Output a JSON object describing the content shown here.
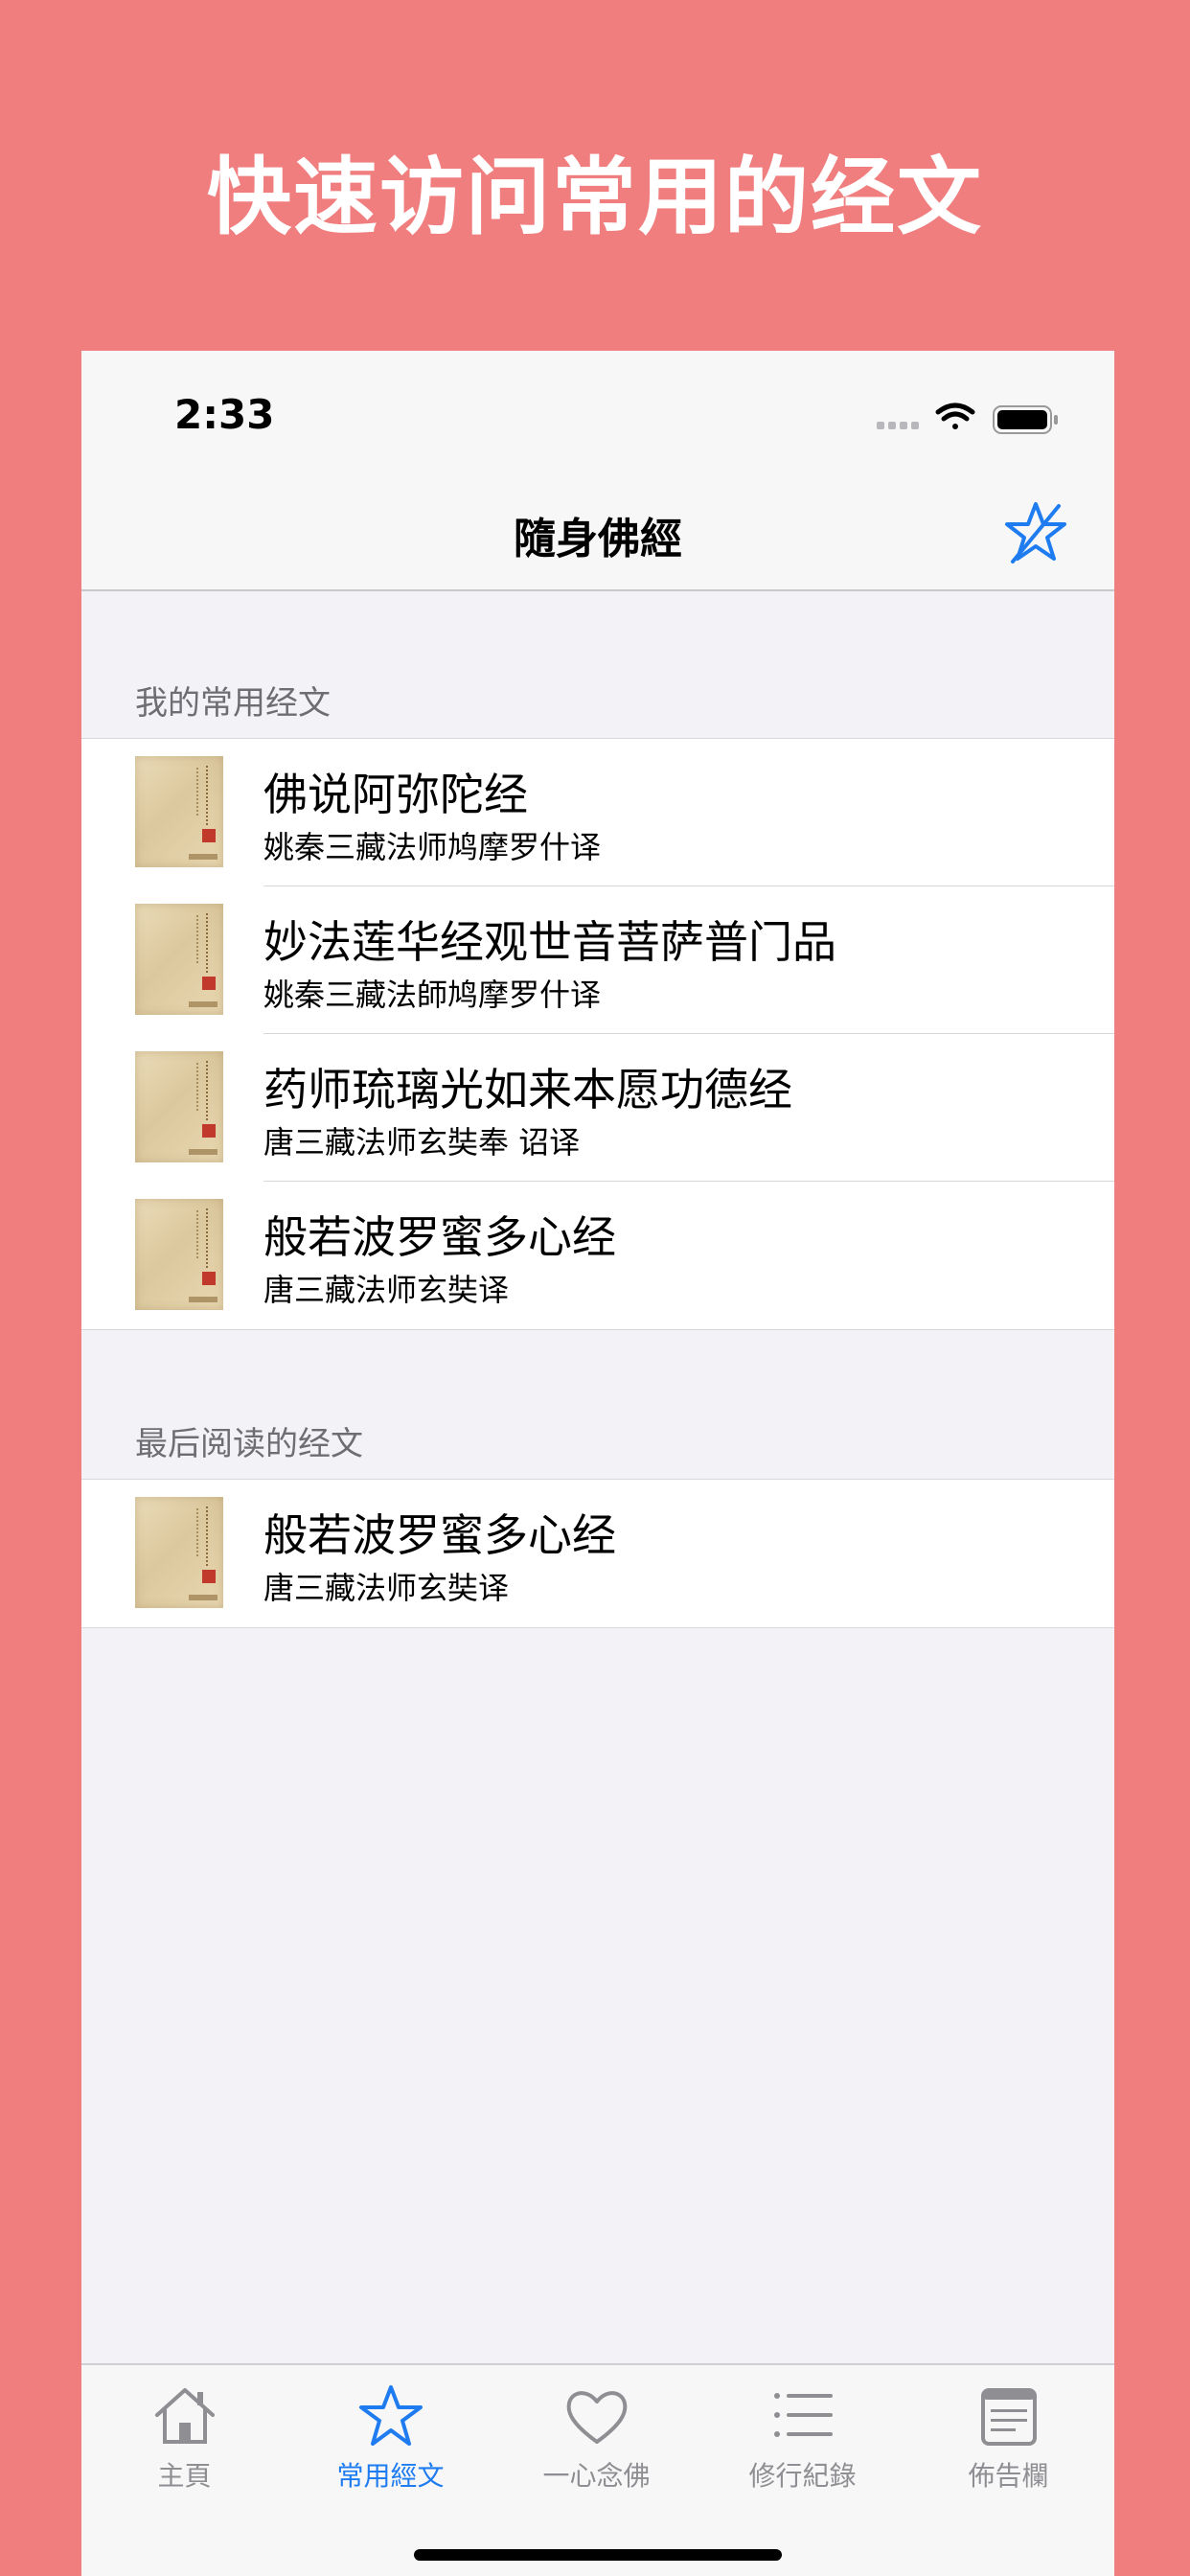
{
  "promo": {
    "title": "快速访问常用的经文"
  },
  "status_bar": {
    "time": "2:33"
  },
  "nav": {
    "title": "隨身佛經",
    "action_icon": "star-icon"
  },
  "sections": {
    "favorites": {
      "header": "我的常用经文",
      "items": [
        {
          "title": "佛说阿弥陀经",
          "subtitle": "姚秦三藏法师鸠摩罗什译"
        },
        {
          "title": "妙法莲华经观世音菩萨普门品",
          "subtitle": "姚秦三藏法師鸠摩罗什译"
        },
        {
          "title": "药师琉璃光如来本愿功德经",
          "subtitle": "唐三藏法师玄奘奉 诏译"
        },
        {
          "title": "般若波罗蜜多心经",
          "subtitle": "唐三藏法师玄奘译"
        }
      ]
    },
    "recent": {
      "header": "最后阅读的经文",
      "items": [
        {
          "title": "般若波罗蜜多心经",
          "subtitle": "唐三藏法师玄奘译"
        }
      ]
    }
  },
  "tabs": [
    {
      "label": "主頁",
      "icon": "home-icon",
      "active": false
    },
    {
      "label": "常用經文",
      "icon": "star-icon",
      "active": true
    },
    {
      "label": "一心念佛",
      "icon": "heart-icon",
      "active": false
    },
    {
      "label": "修行紀錄",
      "icon": "list-icon",
      "active": false
    },
    {
      "label": "佈告欄",
      "icon": "newspaper-icon",
      "active": false
    }
  ],
  "colors": {
    "background": "#F07E7E",
    "accent": "#1E7CF0",
    "inactive": "#8E8E93"
  }
}
